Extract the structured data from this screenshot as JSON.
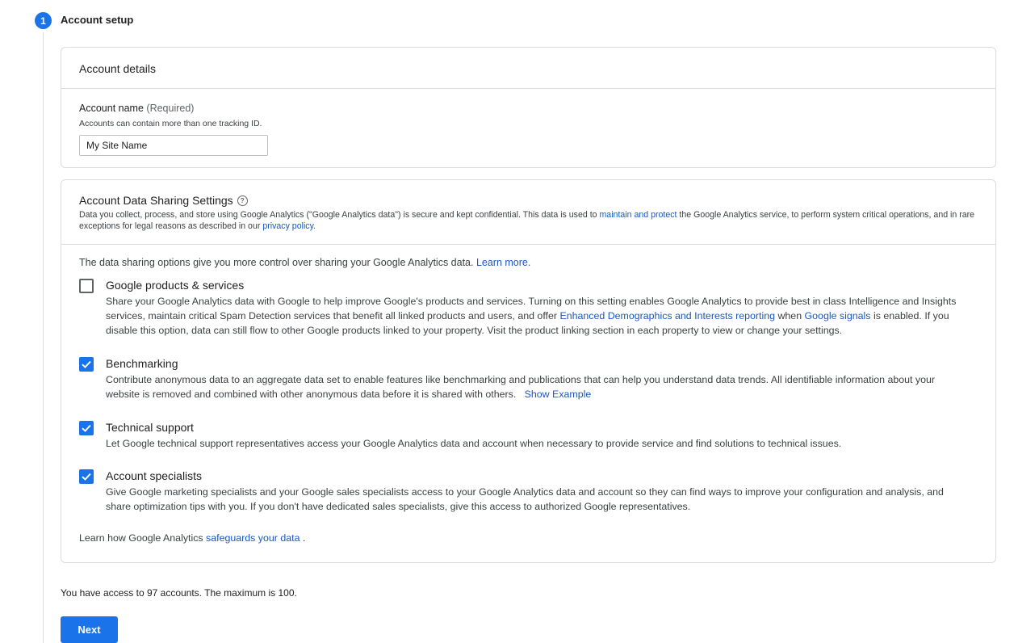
{
  "step": {
    "number": "1",
    "title": "Account setup"
  },
  "account_details": {
    "heading": "Account details",
    "name_label": "Account name",
    "name_required": "(Required)",
    "name_hint": "Accounts can contain more than one tracking ID.",
    "name_value": "My Site Name"
  },
  "data_sharing": {
    "heading": "Account Data Sharing Settings",
    "help_icon": "?",
    "desc_pre": "Data you collect, process, and store using Google Analytics (\"Google Analytics data\") is secure and kept confidential. This data is used to ",
    "desc_link1": "maintain and protect",
    "desc_mid": " the Google Analytics service, to perform system critical operations, and in rare exceptions for legal reasons as described in our ",
    "desc_link2": "privacy policy",
    "desc_post": ".",
    "intro": "The data sharing options give you more control over sharing your Google Analytics data. ",
    "intro_link": "Learn more.",
    "options": [
      {
        "title": "Google products & services",
        "checked": false,
        "desc_pre": "Share your Google Analytics data with Google to help improve Google's products and services. Turning on this setting enables Google Analytics to provide best in class Intelligence and Insights services, maintain critical Spam Detection services that benefit all linked products and users, and offer ",
        "link1": "Enhanced Demographics and Interests reporting",
        "desc_mid": " when ",
        "link2": "Google signals",
        "desc_post": " is enabled. If you disable this option, data can still flow to other Google products linked to your property. Visit the product linking section in each property to view or change your settings."
      },
      {
        "title": "Benchmarking",
        "checked": true,
        "desc": "Contribute anonymous data to an aggregate data set to enable features like benchmarking and publications that can help you understand data trends. All identifiable information about your website is removed and combined with other anonymous data before it is shared with others.",
        "link": "Show Example"
      },
      {
        "title": "Technical support",
        "checked": true,
        "desc": "Let Google technical support representatives access your Google Analytics data and account when necessary to provide service and find solutions to technical issues."
      },
      {
        "title": "Account specialists",
        "checked": true,
        "desc": "Give Google marketing specialists and your Google sales specialists access to your Google Analytics data and account so they can find ways to improve your configuration and analysis, and share optimization tips with you. If you don't have dedicated sales specialists, give this access to authorized Google representatives."
      }
    ],
    "footer_pre": "Learn how Google Analytics ",
    "footer_link": "safeguards your data",
    "footer_post": " ."
  },
  "access_note": "You have access to 97 accounts. The maximum is 100.",
  "next_label": "Next",
  "colors": {
    "accent": "#1a73e8",
    "link": "#1a57c0",
    "border": "#dadce0"
  }
}
